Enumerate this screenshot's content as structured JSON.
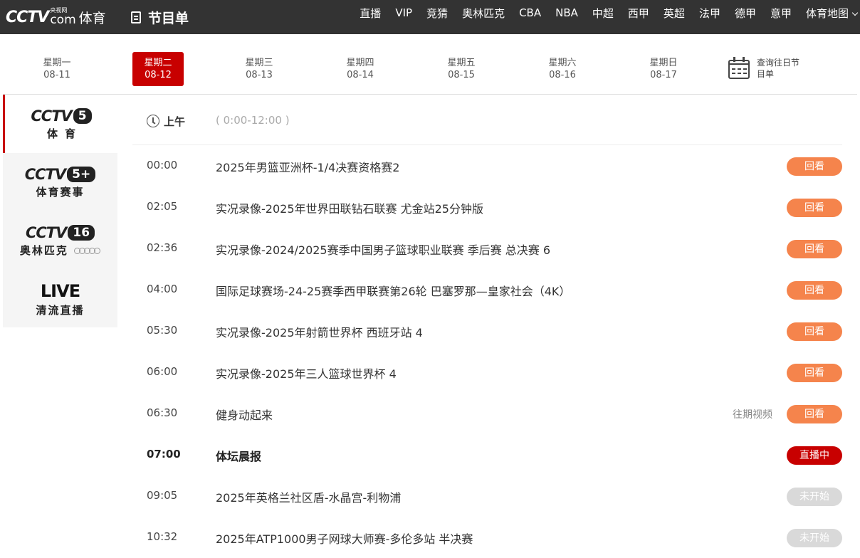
{
  "header": {
    "logo_cctv": "CCTV",
    "logo_small": "央视网",
    "logo_com": "com",
    "logo_sport": "体育",
    "page_title": "节目单",
    "nav": [
      "直播",
      "VIP",
      "竞猜",
      "奥林匹克",
      "CBA",
      "NBA",
      "中超",
      "西甲",
      "英超",
      "法甲",
      "德甲",
      "意甲",
      "体育地图"
    ]
  },
  "dates": [
    {
      "weekday": "星期一",
      "date": "08-11",
      "active": false
    },
    {
      "weekday": "星期二",
      "date": "08-12",
      "active": true
    },
    {
      "weekday": "星期三",
      "date": "08-13",
      "active": false
    },
    {
      "weekday": "星期四",
      "date": "08-14",
      "active": false
    },
    {
      "weekday": "星期五",
      "date": "08-15",
      "active": false
    },
    {
      "weekday": "星期六",
      "date": "08-16",
      "active": false
    },
    {
      "weekday": "星期日",
      "date": "08-17",
      "active": false
    }
  ],
  "history_link": "查询往日节目单",
  "channels": [
    {
      "logo": "CCTV",
      "badge": "5",
      "sub": "体育"
    },
    {
      "logo": "CCTV",
      "badge": "5+",
      "sub": "体育赛事"
    },
    {
      "logo": "CCTV",
      "badge": "16",
      "sub": "奥林匹克"
    },
    {
      "logo": "LIVE",
      "sub": "清流直播"
    }
  ],
  "period": {
    "name": "上午",
    "range": "( 0:00-12:00 )"
  },
  "status_labels": {
    "replay": "回看",
    "live": "直播中",
    "upcoming": "未开始"
  },
  "past_video_label": "往期视频",
  "colors": {
    "accent": "#c80000",
    "replay": "#f5844c",
    "upcoming": "#d9d9d9",
    "topbar": "#333333"
  },
  "programs": [
    {
      "time": "00:00",
      "title": "2025年男篮亚洲杯-1/4决赛资格赛2",
      "status": "replay"
    },
    {
      "time": "02:05",
      "title": "实况录像-2025年世界田联钻石联赛 尤金站25分钟版",
      "status": "replay"
    },
    {
      "time": "02:36",
      "title": "实况录像-2024/2025赛季中国男子篮球职业联赛 季后赛 总决赛 6",
      "status": "replay"
    },
    {
      "time": "04:00",
      "title": "国际足球赛场-24-25赛季西甲联赛第26轮 巴塞罗那—皇家社会（4K）",
      "status": "replay"
    },
    {
      "time": "05:30",
      "title": "实况录像-2025年射箭世界杯 西班牙站 4",
      "status": "replay"
    },
    {
      "time": "06:00",
      "title": "实况录像-2025年三人篮球世界杯 4",
      "status": "replay"
    },
    {
      "time": "06:30",
      "title": "健身动起来",
      "status": "replay",
      "past_video": true
    },
    {
      "time": "07:00",
      "title": "体坛晨报",
      "status": "live"
    },
    {
      "time": "09:05",
      "title": "2025年英格兰社区盾-水晶宫-利物浦",
      "status": "upcoming"
    },
    {
      "time": "10:32",
      "title": "2025年ATP1000男子网球大师赛-多伦多站 半决赛",
      "status": "upcoming"
    }
  ]
}
